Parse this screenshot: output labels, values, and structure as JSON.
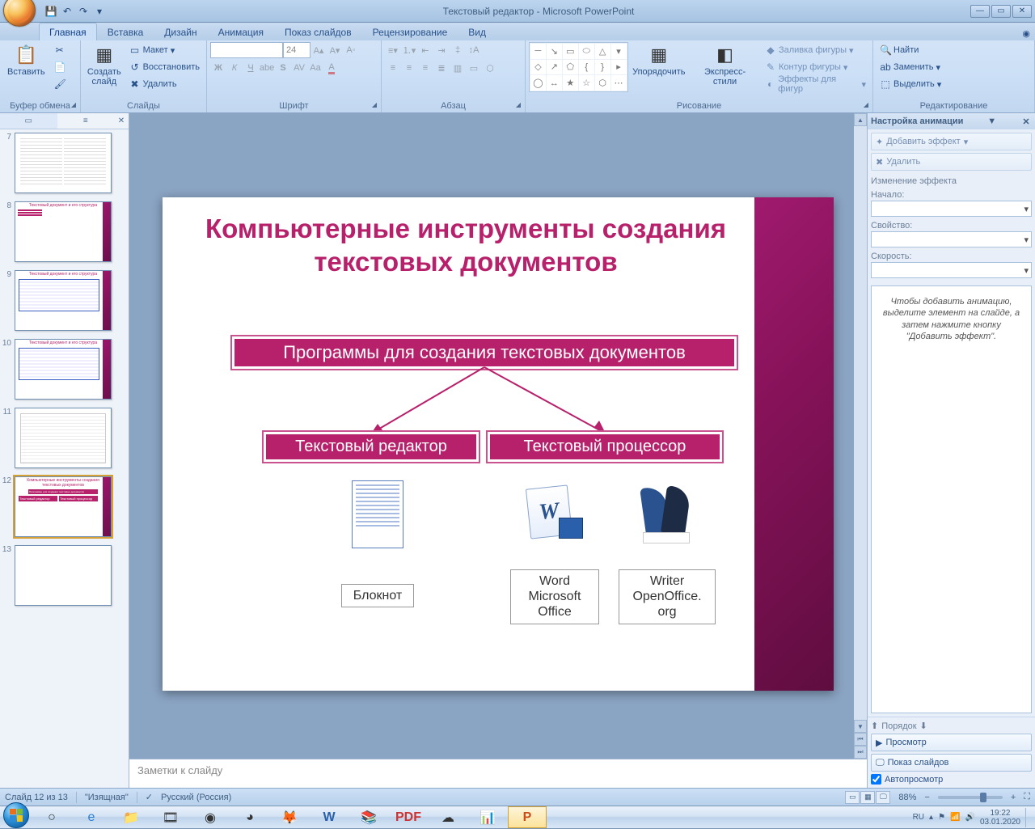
{
  "titlebar": {
    "app_title": "Текстовый редактор - Microsoft PowerPoint"
  },
  "tabs": [
    "Главная",
    "Вставка",
    "Дизайн",
    "Анимация",
    "Показ слайдов",
    "Рецензирование",
    "Вид"
  ],
  "ribbon": {
    "clipboard": {
      "label": "Буфер обмена",
      "paste": "Вставить"
    },
    "slides": {
      "label": "Слайды",
      "new": "Создать\nслайд",
      "layout": "Макет",
      "reset": "Восстановить",
      "delete": "Удалить"
    },
    "font": {
      "label": "Шрифт",
      "size": "24"
    },
    "paragraph": {
      "label": "Абзац"
    },
    "drawing": {
      "label": "Рисование",
      "arrange": "Упорядочить",
      "quick": "Экспресс-стили",
      "fill": "Заливка фигуры",
      "outline": "Контур фигуры",
      "effects": "Эффекты для фигур"
    },
    "editing": {
      "label": "Редактирование",
      "find": "Найти",
      "replace": "Заменить",
      "select": "Выделить"
    }
  },
  "thumbs": {
    "numbers": [
      "7",
      "8",
      "9",
      "10",
      "11",
      "12",
      "13"
    ],
    "selected_index": 5
  },
  "slide": {
    "title": "Компьютерные инструменты создания текстовых документов",
    "main_box": "Программы для создания текстовых документов",
    "left_box": "Текстовый редактор",
    "right_box": "Текстовый процессор",
    "app1": "Блокнот",
    "app2": "Word Microsoft Office",
    "app3": "Writer OpenOffice. org"
  },
  "notes_placeholder": "Заметки к слайду",
  "animpane": {
    "title": "Настройка анимации",
    "add_effect": "Добавить эффект",
    "remove": "Удалить",
    "change_header": "Изменение эффекта",
    "start_label": "Начало:",
    "property_label": "Свойство:",
    "speed_label": "Скорость:",
    "hint": "Чтобы добавить анимацию, выделите элемент на слайде, а затем нажмите кнопку \"Добавить эффект\".",
    "order": "Порядок",
    "preview": "Просмотр",
    "slideshow": "Показ слайдов",
    "autopreview": "Автопросмотр"
  },
  "statusbar": {
    "slide_info": "Слайд 12 из 13",
    "theme": "\"Изящная\"",
    "lang": "Русский (Россия)",
    "zoom": "88%"
  },
  "tray": {
    "lang": "RU",
    "time": "19:22",
    "date": "03.01.2020"
  }
}
